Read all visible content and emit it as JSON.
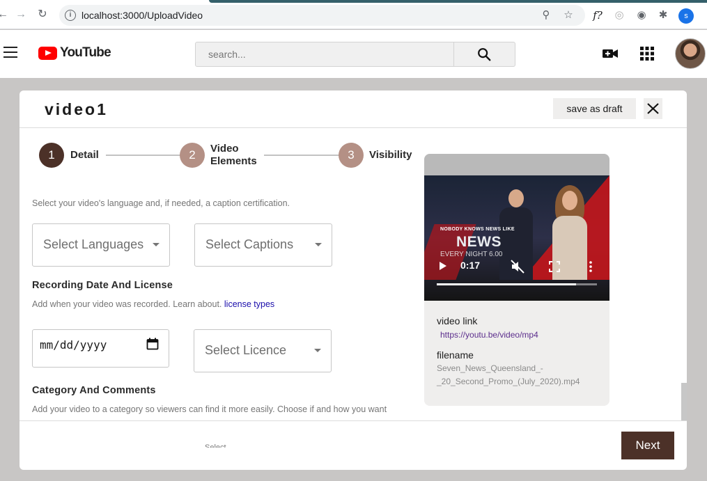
{
  "browser": {
    "url": "localhost:3000/UploadVideo",
    "profile_initial": "s",
    "extension_glyph": "f?"
  },
  "youtube_header": {
    "logo_text": "YouTube",
    "search_placeholder": "search..."
  },
  "modal": {
    "title": "video1",
    "save_draft_label": "save as draft",
    "steps": [
      {
        "number": "1",
        "label": "Detail",
        "state": "active",
        "color": "#4c3128"
      },
      {
        "number": "2",
        "label_line1": "Video",
        "label_line2": "Elements",
        "state": "pending",
        "color": "#b49085"
      },
      {
        "number": "3",
        "label": "Visibility",
        "state": "pending",
        "color": "#b49085"
      }
    ],
    "form": {
      "language_helper": "Select your video's language and, if needed, a caption certification.",
      "select_languages": "Select Languages",
      "select_captions": "Select Captions",
      "recording_heading": "Recording Date And License",
      "recording_helper": "Add when your video was recorded. Learn about.",
      "license_link": "license types",
      "date_placeholder": "mm/dd/yyyy",
      "select_licence": "Select Licence",
      "category_heading": "Category And Comments",
      "category_helper": "Add your video to a category so viewers can find it more easily. Choose if and how you want"
    },
    "footer": {
      "ghost_select": "Select",
      "next_label": "Next"
    },
    "preview": {
      "video_kicker": "NOBODY KNOWS NEWS LIKE",
      "video_brand": "NEWS",
      "video_sub": "EVERY NIGHT 6.00",
      "current_time": "0:17",
      "progress": 0.87,
      "video_link_label": "video link",
      "video_link": "https://youtu.be/video/mp4",
      "filename_label": "filename",
      "filename_line1": "Seven_News_Queensland_-",
      "filename_line2": "_20_Second_Promo_(July_2020).mp4"
    }
  },
  "colors": {
    "accent_dark": "#4c3128",
    "step_pending": "#b49085",
    "yt_red": "#ff0000"
  }
}
